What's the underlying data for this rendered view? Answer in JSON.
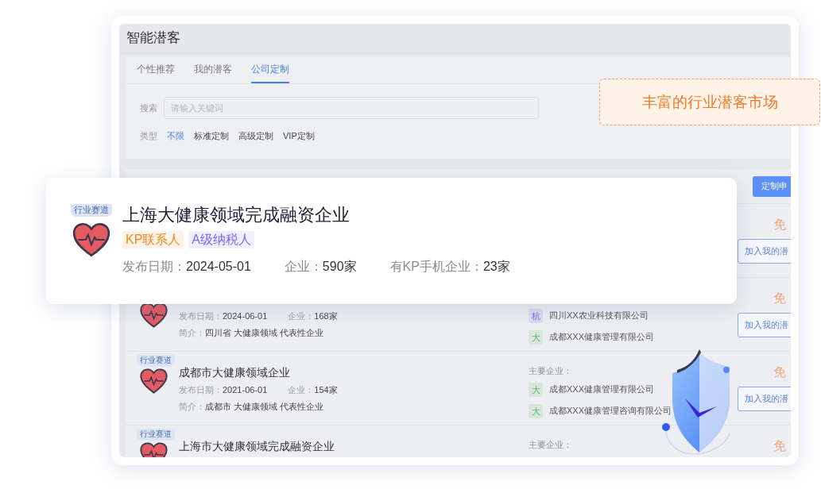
{
  "app": {
    "title": "智能潜客"
  },
  "tabs": [
    {
      "label": "个性推荐",
      "selected": false
    },
    {
      "label": "我的潜客",
      "selected": false
    },
    {
      "label": "公司定制",
      "selected": true
    }
  ],
  "search": {
    "label": "搜索",
    "placeholder": "请输入关键词"
  },
  "type_filter": {
    "label": "类型",
    "options": [
      {
        "label": "不限",
        "selected": true
      },
      {
        "label": "标准定制",
        "selected": false
      },
      {
        "label": "高级定制",
        "selected": false
      },
      {
        "label": "VIP定制",
        "selected": false
      }
    ]
  },
  "apply_button": "定制申",
  "rows": [
    {
      "price": "免",
      "add_button": "加入我的潜"
    },
    {
      "date_label": "发布日期：",
      "date": "2024-06-01",
      "count_label": "企业：",
      "count": "168家",
      "intro_label": "简介：",
      "intro": "四川省 大健康领域 代表性企业",
      "companies": [
        {
          "mark": "杭",
          "name": "四川XX农业科技有限公司",
          "color": "#7b6fd6"
        },
        {
          "mark": "大",
          "name": "成都XXX健康管理有限公司",
          "color": "#5fb36a"
        }
      ],
      "price": "免",
      "add_button": "加入我的潜"
    },
    {
      "track_tag": "行业赛道",
      "title": "成都市大健康领域企业",
      "date_label": "发布日期：",
      "date": "2021-06-01",
      "count_label": "企业：",
      "count": "154家",
      "intro_label": "简介：",
      "intro": "成都市 大健康领域 代表性企业",
      "companies_label": "主要企业：",
      "companies": [
        {
          "mark": "大",
          "name": "成都XXX健康管理有限公司",
          "color": "#5fb36a"
        },
        {
          "mark": "大",
          "name": "成都XXX健康管理咨询有限公司",
          "color": "#5fb36a"
        }
      ],
      "price": "免",
      "add_button": "加入我的潜"
    },
    {
      "track_tag": "行业赛道",
      "title": "上海市大健康领域完成融资企业",
      "companies_label": "主要企业：",
      "price": "免"
    }
  ],
  "featured_card": {
    "track_tag": "行业赛道",
    "title": "上海大健康领域完成融资企业",
    "tags": [
      {
        "label": "KP联系人",
        "color": "#f08a24"
      },
      {
        "label": "A级纳税人",
        "color": "#7b68ee"
      }
    ],
    "date_label": "发布日期：",
    "date": "2024-05-01",
    "count_label": "企业：",
    "count": "590家",
    "kp_label": "有KP手机企业：",
    "kp_count": "23家"
  },
  "callout": {
    "text": "丰富的行业潜客市场"
  }
}
